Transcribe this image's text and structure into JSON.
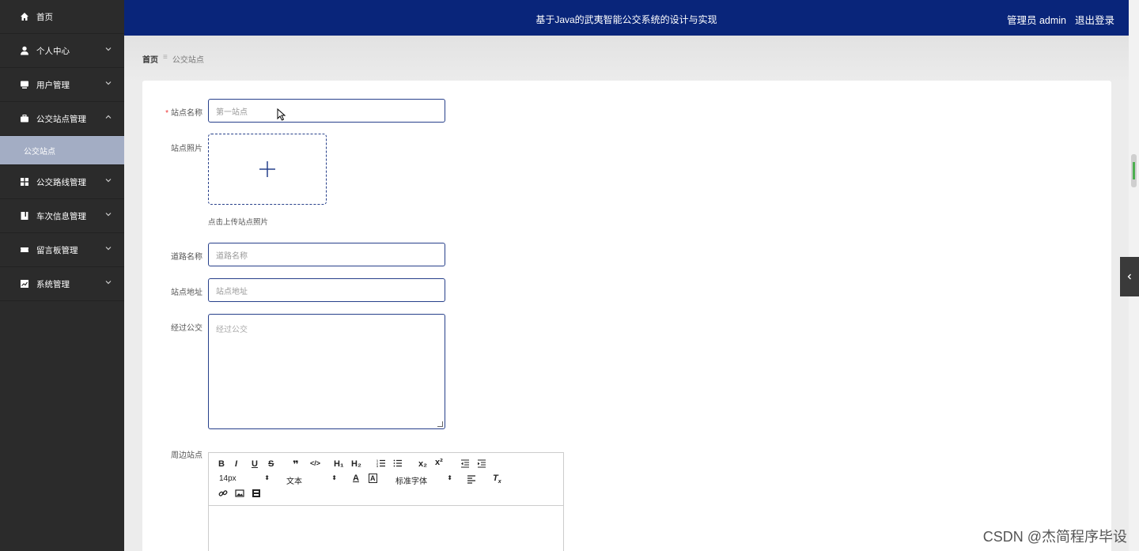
{
  "app": {
    "title": "基于Java的武夷智能公交系统的设计与实现",
    "user": "管理员 admin",
    "logout": "退出登录"
  },
  "sidebar": {
    "items": [
      {
        "label": "首页",
        "icon": "home-icon"
      },
      {
        "label": "个人中心",
        "icon": "user-icon"
      },
      {
        "label": "用户管理",
        "icon": "monitor-icon"
      },
      {
        "label": "公交站点管理",
        "icon": "briefcase-icon",
        "expanded": true
      },
      {
        "label": "公交站点",
        "sub": true,
        "active": true
      },
      {
        "label": "公交路线管理",
        "icon": "grid-icon"
      },
      {
        "label": "车次信息管理",
        "icon": "book-icon"
      },
      {
        "label": "留言板管理",
        "icon": "ticket-icon"
      },
      {
        "label": "系统管理",
        "icon": "chart-icon"
      }
    ]
  },
  "breadcrumb": {
    "home": "首页",
    "separator": "≡",
    "current": "公交站点"
  },
  "form": {
    "name_label": "站点名称",
    "name_required": "*",
    "name_placeholder": "第一站点",
    "photo_label": "站点照片",
    "photo_hint": "点击上传站点照片",
    "road_label": "道路名称",
    "road_placeholder": "道路名称",
    "address_label": "站点地址",
    "address_placeholder": "站点地址",
    "bus_label": "经过公交",
    "bus_placeholder": "经过公交",
    "nearby_label": "周边站点"
  },
  "editor": {
    "font_size": "14px",
    "header_type": "文本",
    "font_family": "标准字体"
  },
  "watermark": "CSDN @杰简程序毕设",
  "colors": {
    "topbar": "#09257a",
    "sidebar": "#2b2b2b",
    "active_item": "#a3adc4",
    "input_border": "#27408b"
  }
}
